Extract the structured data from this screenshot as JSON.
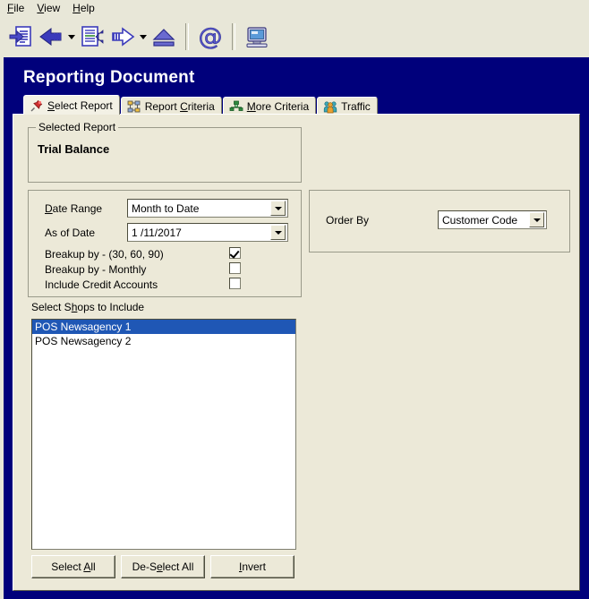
{
  "menu": {
    "items": [
      {
        "label": "File",
        "accel": "F"
      },
      {
        "label": "View",
        "accel": "V"
      },
      {
        "label": "Help",
        "accel": "H"
      }
    ]
  },
  "toolbar": {
    "buttons": [
      {
        "name": "new-report-icon",
        "title": "New Report"
      },
      {
        "name": "back-arrow-icon",
        "title": "Back"
      },
      {
        "name": "back-arrow-dropdown-icon",
        "title": "Back history"
      },
      {
        "name": "previous-page-icon",
        "title": "Previous"
      },
      {
        "name": "forward-arrow-icon",
        "title": "Forward"
      },
      {
        "name": "forward-arrow-dropdown-icon",
        "title": "Forward history"
      },
      {
        "name": "eject-icon",
        "title": "Eject"
      },
      {
        "name": "email-at-icon",
        "title": "Email"
      },
      {
        "name": "computer-monitor-icon",
        "title": "Preview"
      }
    ]
  },
  "window": {
    "title": "Reporting Document"
  },
  "tabs": [
    {
      "label": "Select Report",
      "accel_index": 1,
      "icon": "pushpin-icon",
      "active": true
    },
    {
      "label": "Report Criteria",
      "accel_index": 8,
      "icon": "org-chart-icon",
      "active": false
    },
    {
      "label": "More Criteria",
      "accel_index": 1,
      "icon": "connector-icon",
      "active": false
    },
    {
      "label": "Traffic",
      "accel_index": -1,
      "icon": "people-icon",
      "active": false
    }
  ],
  "selected_report": {
    "group_label": "Selected Report",
    "value": "Trial Balance"
  },
  "criteria": {
    "date_range": {
      "label_pre": "D",
      "label_accel": "a",
      "label_post": "te Range",
      "label": "Date Range",
      "value": "Month to Date"
    },
    "as_of_date": {
      "label": "As of Date",
      "value": "1 /11/2017"
    },
    "checkboxes": [
      {
        "label": "Breakup by - (30, 60, 90)",
        "checked": true
      },
      {
        "label": "Breakup by - Monthly",
        "checked": false
      },
      {
        "label": "Include Credit Accounts",
        "checked": false
      }
    ]
  },
  "order_by": {
    "label": "Order By",
    "value": "Customer Code"
  },
  "shops": {
    "group_label_pre": "Select S",
    "group_label_accel": "h",
    "group_label_post": "ops to Include",
    "group_label": "Select Shops to Include",
    "items": [
      {
        "label": "POS Newsagency 1",
        "selected": true
      },
      {
        "label": "POS Newsagency 2",
        "selected": false
      }
    ]
  },
  "buttons": [
    {
      "pre": "Select ",
      "accel": "A",
      "post": "ll",
      "label": "Select All",
      "name": "select-all-button"
    },
    {
      "pre": "De-S",
      "accel": "e",
      "post": "lect All",
      "label": "De-Select All",
      "name": "de-select-all-button"
    },
    {
      "pre": "",
      "accel": "I",
      "post": "nvert",
      "label": "Invert",
      "name": "invert-button"
    }
  ],
  "colors": {
    "window_chrome": "#00007b",
    "face": "#ece9d8",
    "selection": "#1f57b5",
    "accent_blue": "#3b3bbb"
  }
}
